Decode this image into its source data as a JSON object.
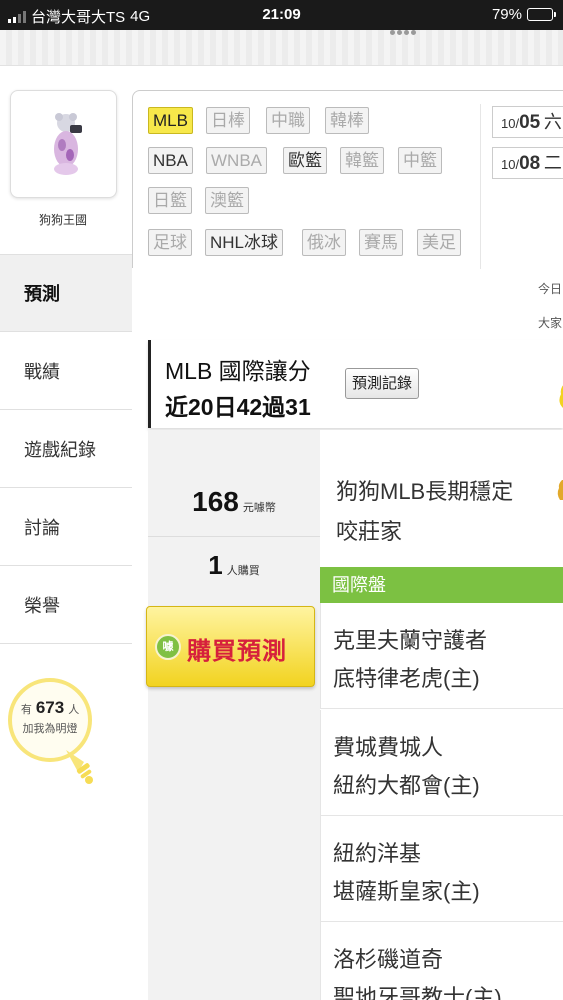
{
  "status_bar": {
    "carrier": "台灣大哥大TS",
    "network": "4G",
    "time": "21:09",
    "battery": "79%",
    "battery_level": 0.79
  },
  "profile": {
    "shop_name": "狗狗王國",
    "followers_prefix": "有",
    "followers_count": "673",
    "followers_unit": "人",
    "followers_suffix": "加我為明燈"
  },
  "nav": {
    "items": [
      {
        "label": "預測",
        "active": true
      },
      {
        "label": "戰績",
        "active": false
      },
      {
        "label": "遊戲紀錄",
        "active": false
      },
      {
        "label": "討論",
        "active": false
      },
      {
        "label": "榮譽",
        "active": false
      }
    ]
  },
  "leagues": {
    "tags": [
      {
        "label": "MLB",
        "state": "selected"
      },
      {
        "label": "日棒",
        "state": "disabled"
      },
      {
        "label": "中職",
        "state": "disabled"
      },
      {
        "label": "韓棒",
        "state": "disabled"
      },
      {
        "label": "NBA",
        "state": "enabled"
      },
      {
        "label": "WNBA",
        "state": "disabled"
      },
      {
        "label": "歐籃",
        "state": "enabled"
      },
      {
        "label": "韓籃",
        "state": "disabled"
      },
      {
        "label": "中籃",
        "state": "disabled"
      },
      {
        "label": "日籃",
        "state": "disabled"
      },
      {
        "label": "澳籃",
        "state": "disabled"
      },
      {
        "label": "足球",
        "state": "disabled"
      },
      {
        "label": "NHL冰球",
        "state": "enabled"
      },
      {
        "label": "俄冰",
        "state": "disabled"
      },
      {
        "label": "賽馬",
        "state": "disabled"
      },
      {
        "label": "美足",
        "state": "disabled"
      }
    ],
    "dates": [
      {
        "month": "10/",
        "day": "05",
        "weekday": "六"
      },
      {
        "month": "10/",
        "day": "08",
        "weekday": "二"
      }
    ],
    "side_notes": [
      "今日",
      "大家"
    ]
  },
  "prediction": {
    "header_line1": "MLB 國際讓分",
    "header_line2": "近20日42過31",
    "record_button": "預測記錄",
    "price": "168",
    "price_unit": "元噱幣",
    "buyers": "1",
    "buyers_unit": "人購買",
    "buy_button": "購買預測",
    "buy_icon_char": "噱",
    "title_line1": "狗狗MLB長期穩定",
    "title_line2": "咬莊家",
    "section_label": "國際盤",
    "games": [
      {
        "away": "克里夫蘭守護者",
        "home": "底特律老虎(主)"
      },
      {
        "away": "費城費城人",
        "home": "紐約大都會(主)"
      },
      {
        "away": "紐約洋基",
        "home": "堪薩斯皇家(主)"
      },
      {
        "away": "洛杉磯道奇",
        "home": "聖地牙哥教士(主)"
      }
    ]
  },
  "colors": {
    "selected_tag": "#f7e84a",
    "section_green": "#7cc142",
    "buy_text": "#d6203c",
    "bulb_yellow": "#f8e57a"
  },
  "icons": [
    "signal-icon",
    "battery-icon",
    "page-dots-icon",
    "lightbulb-icon",
    "coin-icon",
    "money-bag-icon",
    "trophy-icon"
  ]
}
